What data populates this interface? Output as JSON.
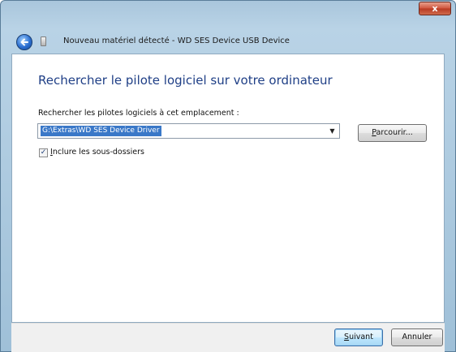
{
  "window": {
    "title": "Nouveau matériel détecté - WD SES Device USB Device",
    "close_label": "x"
  },
  "content": {
    "heading": "Rechercher le pilote logiciel sur votre ordinateur",
    "field_label": "Rechercher les pilotes logiciels à cet emplacement :",
    "path_value": "G:\\Extras\\WD SES Device Driver",
    "browse_button": {
      "mnemonic": "P",
      "rest": "arcourir..."
    },
    "include_subfolders": {
      "checked": true,
      "label_mnemonic": "I",
      "label_rest": "nclure les sous-dossiers"
    }
  },
  "footer": {
    "next_button": {
      "mnemonic": "S",
      "rest": "uivant"
    },
    "cancel_button": "Annuler"
  },
  "colors": {
    "heading": "#1f3f86",
    "selection": "#3a78c8",
    "frame": "#a9c6dc"
  },
  "icons": {
    "back": "back-arrow-icon",
    "device": "device-icon",
    "dropdown": "chevron-down-icon",
    "checkbox": "checkmark-icon"
  }
}
